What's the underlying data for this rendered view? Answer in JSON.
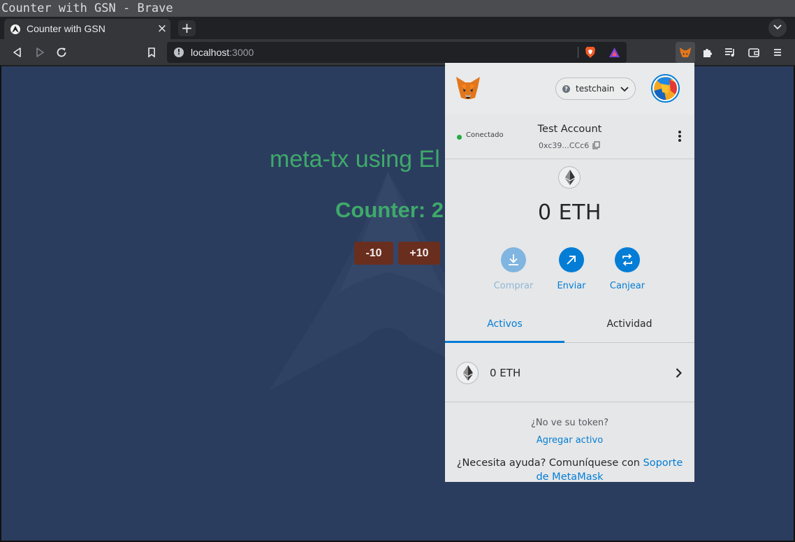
{
  "window": {
    "title": "Counter with GSN - Brave"
  },
  "tab": {
    "title": "Counter with GSN",
    "close": "×"
  },
  "new_tab_label": "+",
  "url": {
    "host": "localhost",
    "port": ":3000",
    "info": "!"
  },
  "page": {
    "heading": "meta-tx using El",
    "counter": "Counter: 2",
    "buttons": {
      "minus": "-10",
      "plus": "+10"
    }
  },
  "metamask": {
    "network": {
      "name": "testchain",
      "icon": "?"
    },
    "status": "Conectado",
    "account": {
      "name": "Test Account",
      "address": "0xc39...CCc6"
    },
    "balance": "0 ETH",
    "actions": {
      "buy": "Comprar",
      "send": "Enviar",
      "swap": "Canjear"
    },
    "tabs": {
      "assets": "Activos",
      "activity": "Actividad"
    },
    "asset": {
      "label": "0 ETH"
    },
    "footer": {
      "not_seeing": "¿No ve su token?",
      "add_token": "Agregar activo",
      "help_prefix": "¿Necesita ayuda? Comuníquese con ",
      "help_link": "Soporte de MetaMask"
    }
  },
  "colors": {
    "page_bg": "#2b3d5e",
    "heading_green": "#3ea96b",
    "button_brown": "#6a2e1f",
    "metamask_blue": "#037dd6"
  }
}
